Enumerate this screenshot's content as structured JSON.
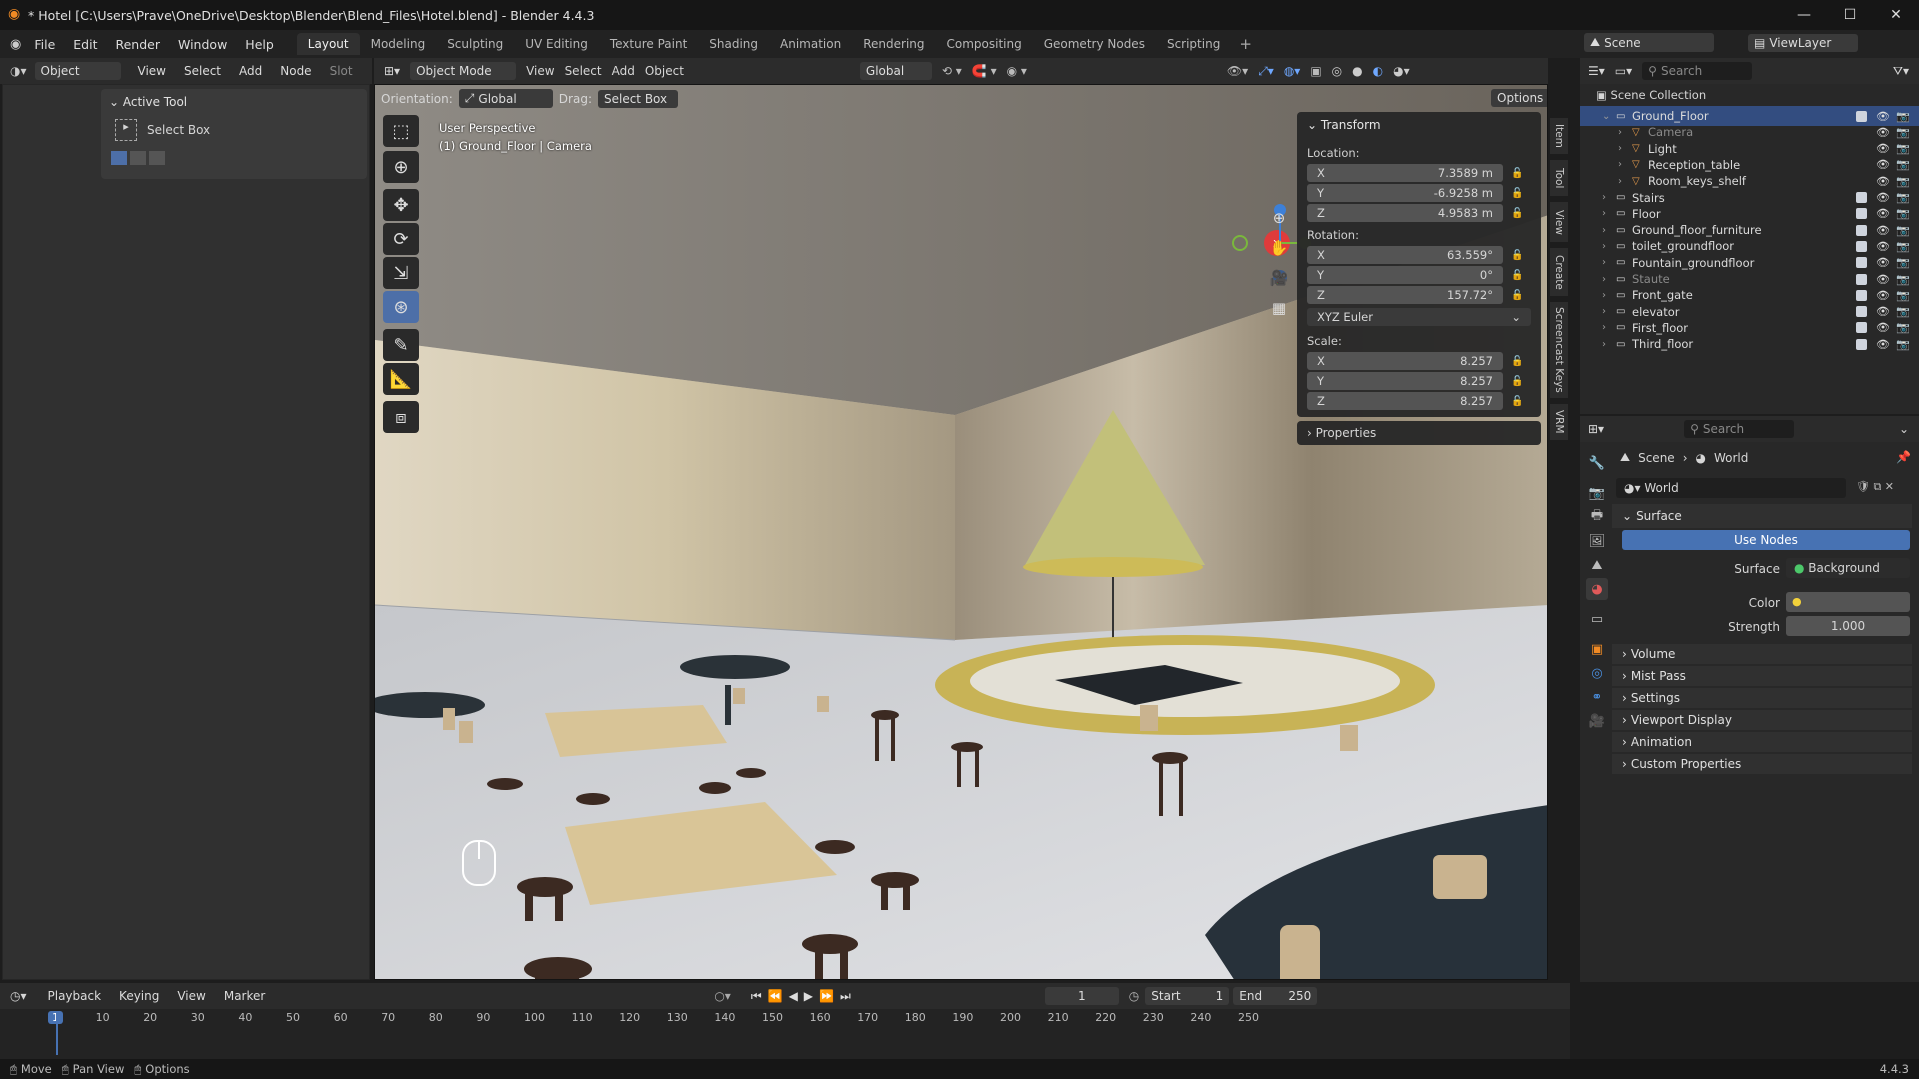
{
  "window": {
    "title": "* Hotel [C:\\Users\\Prave\\OneDrive\\Desktop\\Blender\\Blend_Files\\Hotel.blend] - Blender 4.4.3",
    "minimize": "—",
    "maximize": "☐",
    "close": "✕"
  },
  "menu": [
    "File",
    "Edit",
    "Render",
    "Window",
    "Help"
  ],
  "workspaces": [
    "Layout",
    "Modeling",
    "Sculpting",
    "UV Editing",
    "Texture Paint",
    "Shading",
    "Animation",
    "Rendering",
    "Compositing",
    "Geometry Nodes",
    "Scripting"
  ],
  "scene": {
    "label": "Scene",
    "viewlayer": "ViewLayer"
  },
  "props_editor": {
    "mode": "Object",
    "menus": [
      "View",
      "Select",
      "Add",
      "Node"
    ],
    "slot": "Slot",
    "active_tool": "Active Tool",
    "tool_name": "Select Box"
  },
  "viewport": {
    "mode": "Object Mode",
    "menus": [
      "View",
      "Select",
      "Add",
      "Object"
    ],
    "transform": "Global",
    "orientation_label": "Orientation:",
    "orientation": "Global",
    "drag_label": "Drag:",
    "drag": "Select Box",
    "options": "Options",
    "info1": "User Perspective",
    "info2": "(1) Ground_Floor | Camera"
  },
  "npanel": {
    "transform": "Transform",
    "location": "Location:",
    "rotation": "Rotation:",
    "scale": "Scale:",
    "loc": {
      "x": "7.3589 m",
      "y": "-6.9258 m",
      "z": "4.9583 m"
    },
    "rot": {
      "x": "63.559°",
      "y": "0°",
      "z": "157.72°"
    },
    "euler": "XYZ Euler",
    "scl": {
      "x": "8.257",
      "y": "8.257",
      "z": "8.257"
    },
    "properties": "Properties",
    "axes": [
      "X",
      "Y",
      "Z"
    ]
  },
  "side_tabs": [
    "Item",
    "Tool",
    "View",
    "Create",
    "Screencast Keys",
    "VRM"
  ],
  "outliner": {
    "search": "Search",
    "title": "Scene Collection",
    "rows": [
      {
        "name": "Ground_Floor",
        "indent": 0,
        "top": true
      },
      {
        "name": "Camera",
        "indent": 1,
        "dim": true
      },
      {
        "name": "Light",
        "indent": 1
      },
      {
        "name": "Reception_table",
        "indent": 1
      },
      {
        "name": "Room_keys_shelf",
        "indent": 1
      },
      {
        "name": "Stairs",
        "indent": 0
      },
      {
        "name": "Floor",
        "indent": 0
      },
      {
        "name": "Ground_floor_furniture",
        "indent": 0
      },
      {
        "name": "toilet_groundfloor",
        "indent": 0
      },
      {
        "name": "Fountain_groundfloor",
        "indent": 0
      },
      {
        "name": "Staute",
        "indent": 0,
        "dim": true
      },
      {
        "name": "Front_gate",
        "indent": 0
      },
      {
        "name": "elevator",
        "indent": 0
      },
      {
        "name": "First_floor",
        "indent": 0
      },
      {
        "name": "Third_floor",
        "indent": 0
      }
    ]
  },
  "world": {
    "search": "Search",
    "crumb_scene": "Scene",
    "crumb_world": "World",
    "name": "World",
    "surface": "Surface",
    "use_nodes": "Use Nodes",
    "surface_label": "Surface",
    "surface_value": "Background",
    "color_label": "Color",
    "strength_label": "Strength",
    "strength": "1.000",
    "sections": [
      "Volume",
      "Mist Pass",
      "Settings",
      "Viewport Display",
      "Animation",
      "Custom Properties"
    ]
  },
  "timeline": {
    "menus": [
      "Playback",
      "Keying",
      "View",
      "Marker"
    ],
    "frame": "1",
    "start_label": "Start",
    "start": "1",
    "end_label": "End",
    "end": "250",
    "ticks": [
      "1",
      "10",
      "20",
      "30",
      "40",
      "50",
      "60",
      "70",
      "80",
      "90",
      "100",
      "110",
      "120",
      "130",
      "140",
      "150",
      "160",
      "170",
      "180",
      "190",
      "200",
      "210",
      "220",
      "230",
      "240",
      "250"
    ]
  },
  "status": {
    "move": "Move",
    "pan": "Pan View",
    "options": "Options",
    "version": "4.4.3"
  }
}
